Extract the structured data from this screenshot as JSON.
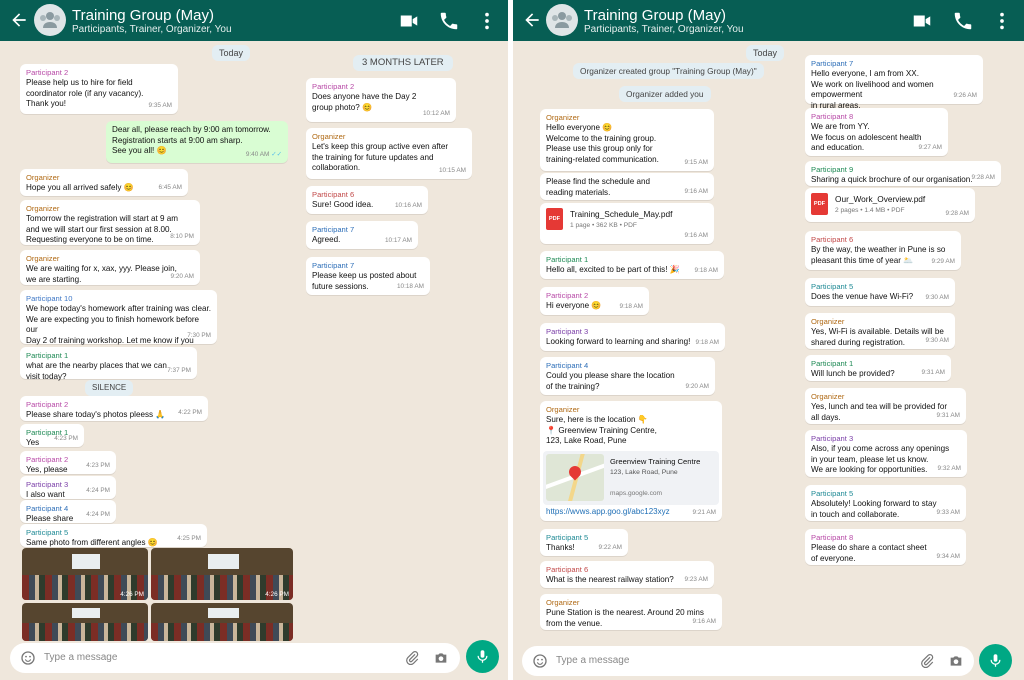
{
  "left": {
    "header": {
      "title": "Training Group (May)",
      "subtitle": "Participants, Trainer, Organizer, You"
    },
    "pill_today": "Today",
    "pill_later": "3 MONTHS LATER",
    "pill_silence": "SILENCE",
    "col1": [
      {
        "sender": "Participant 2",
        "text": "Please help us to hire for field\ncoordinator role (if any vacancy).\nThank you!",
        "time": "9:35 AM"
      },
      {
        "sender": "",
        "text": "Dear all, please reach by 9:00 am tomorrow.\nRegistration starts at 9:00 am sharp.\nSee you all! 😊",
        "time": "9:40 AM"
      },
      {
        "sender": "Organizer",
        "text": "Hope you all arrived safely 😊",
        "time": "6:45 AM"
      },
      {
        "sender": "Organizer",
        "text": "Tomorrow the registration will start at 9 am\nand we will start our first session at 8.00.\nRequesting everyone to be on time.",
        "time": "8:10 PM"
      },
      {
        "sender": "Organizer",
        "text": "We are waiting for x, xax, yyy. Please join,\nwe are starting.",
        "time": "9:20 AM"
      },
      {
        "sender": "Participant 10",
        "text": "We hope today's homework after training was clear.\nWe are expecting you to finish homework before our\nDay 2 of training workshop. Let me know if you\nhave any questions.",
        "time": "7:30 PM"
      },
      {
        "sender": "Participant 1",
        "text": "what are the nearby places that we can\nvisit today?",
        "time": "7:37 PM"
      },
      {
        "sender": "Participant 2",
        "text": "Please share today's photos pleess 🙏",
        "time": "4:22 PM"
      },
      {
        "sender": "Participant 1",
        "text": "Yes",
        "time": "4:23 PM"
      },
      {
        "sender": "Participant 2",
        "text": "Yes, please",
        "time": "4:23 PM"
      },
      {
        "sender": "Participant 3",
        "text": "I also want",
        "time": "4:24 PM"
      },
      {
        "sender": "Participant 4",
        "text": "Please share",
        "time": "4:24 PM"
      },
      {
        "sender": "Participant 5",
        "text": "Same photo from different angles 😊",
        "time": "4:25 PM"
      }
    ],
    "photos": [
      "4:26 PM",
      "4:26 PM",
      "",
      ""
    ],
    "col2": [
      {
        "sender": "Participant 2",
        "text": "Does anyone have the Day 2\ngroup photo? 😊",
        "time": "10:12 AM"
      },
      {
        "sender": "Organizer",
        "text": "Let's keep this group active even after\nthe training for future updates and\ncollaboration.",
        "time": "10:15 AM"
      },
      {
        "sender": "Participant 6",
        "text": "Sure! Good idea.",
        "time": "10:16 AM"
      },
      {
        "sender": "Participant 7",
        "text": "Agreed.",
        "time": "10:17 AM"
      },
      {
        "sender": "Participant 7",
        "text": "Please keep us posted about\nfuture sessions.",
        "time": "10:18 AM"
      }
    ],
    "input": {
      "placeholder": "Type a message"
    }
  },
  "right": {
    "header": {
      "title": "Training Group (May)",
      "subtitle": "Participants, Trainer, Organizer, You"
    },
    "pill_today": "Today",
    "sys1": "Organizer created group \"Training Group (May)\"",
    "sys2": "Organizer added you",
    "col1": [
      {
        "sender": "Organizer",
        "text": "Hello everyone 😊\nWelcome to the training group.\nPlease use this group only for\ntraining-related communication.",
        "time": "9:15 AM"
      },
      {
        "sender": "",
        "text": "Please find the schedule and\nreading materials.",
        "time": "9:16 AM"
      },
      {
        "sender": "Participant 1",
        "text": "Hello all, excited to be part of this! 🎉",
        "time": "9:18 AM"
      },
      {
        "sender": "Participant 2",
        "text": "Hi everyone 😊",
        "time": "9:18 AM"
      },
      {
        "sender": "Participant 3",
        "text": "Looking forward to learning and sharing!",
        "time": "9:18 AM"
      },
      {
        "sender": "Participant 4",
        "text": "Could you please share the location\nof the training?",
        "time": "9:20 AM"
      },
      {
        "sender": "Organizer",
        "text": "Sure, here is the location 👇\n📍 Greenview Training Centre,\n123, Lake Road, Pune",
        "time": ""
      },
      {
        "sender": "Participant 5",
        "text": "Thanks!",
        "time": "9:22 AM"
      },
      {
        "sender": "Participant 6",
        "text": "What is the nearest railway station?",
        "time": "9:23 AM"
      },
      {
        "sender": "Organizer",
        "text": "Pune Station is the nearest. Around 20 mins\nfrom the venue.",
        "time": "9:16 AM"
      }
    ],
    "pdf1": {
      "name": "Training_Schedule_May.pdf",
      "meta": "1 page • 362 KB • PDF",
      "time": "9:16 AM",
      "icon": "PDF"
    },
    "map": {
      "name": "Greenview Training Centre",
      "addr": "123, Lake Road, Pune",
      "domain": "maps.google.com",
      "link": "https://wvws.app.goo.gl/abc123xyz",
      "time": "9:21 AM"
    },
    "col2": [
      {
        "sender": "Participant 7",
        "text": "Hello everyone, I am from XX.\nWe work on livelihood and women empowerment\nin rural areas.",
        "time": "9:26 AM"
      },
      {
        "sender": "Participant 8",
        "text": "We are from YY.\nWe focus on adolescent health\nand education.",
        "time": "9:27 AM"
      },
      {
        "sender": "Participant 9",
        "text": "Sharing a quick brochure of our organisation.",
        "time": "9:28 AM"
      },
      {
        "sender": "Participant 6",
        "text": "By the way, the weather in Pune is so\npleasant this time of year 🌥️",
        "time": "9:29 AM"
      },
      {
        "sender": "Participant 5",
        "text": "Does the venue have Wi-Fi?",
        "time": "9:30 AM"
      },
      {
        "sender": "Organizer",
        "text": "Yes, Wi-Fi is available. Details will be\nshared during registration.",
        "time": "9:30 AM"
      },
      {
        "sender": "Participant 1",
        "text": "Will lunch be provided?",
        "time": "9:31 AM"
      },
      {
        "sender": "Organizer",
        "text": "Yes, lunch and tea will be provided for\nall days.",
        "time": "9:31 AM"
      },
      {
        "sender": "Participant 3",
        "text": "Also, if you come across any openings\nin your team, please let us know.\nWe are looking for opportunities.",
        "time": "9:32 AM"
      },
      {
        "sender": "Participant 5",
        "text": "Absolutely! Looking forward to stay\nin touch and collaborate.",
        "time": "9:33 AM"
      },
      {
        "sender": "Participant 8",
        "text": "Please do share a contact sheet\nof everyone.",
        "time": "9:34 AM"
      }
    ],
    "pdf2": {
      "name": "Our_Work_Overview.pdf",
      "meta": "2 pages • 1.4 MB • PDF",
      "time": "9:28 AM",
      "icon": "PDF"
    },
    "input": {
      "placeholder": "Type a message"
    }
  },
  "icons": [
    "back-arrow-icon",
    "group-avatar-icon",
    "video-call-icon",
    "phone-icon",
    "more-vert-icon",
    "emoji-icon",
    "attach-icon",
    "camera-icon",
    "mic-icon",
    "pdf-icon",
    "location-pin-icon",
    "read-receipt-icon"
  ],
  "colors": {
    "header": "#075e54",
    "chat_bg": "#efe7dc",
    "outgoing": "#d9fdd3",
    "accent": "#00a884"
  }
}
